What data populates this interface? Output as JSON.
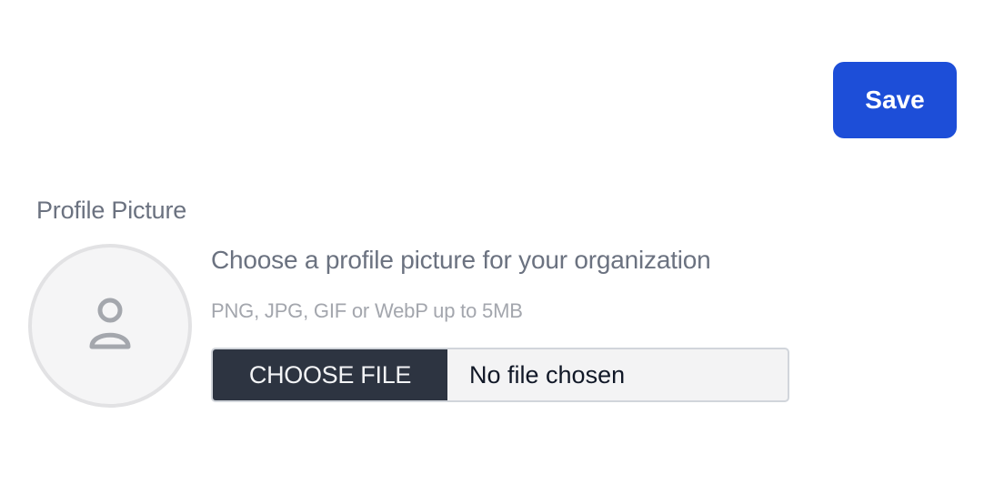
{
  "toolbar": {
    "save_label": "Save"
  },
  "profile_picture": {
    "label": "Profile Picture",
    "description": "Choose a profile picture for your organization",
    "hint": "PNG, JPG, GIF or WebP up to 5MB",
    "choose_file_label": "CHOOSE FILE",
    "file_status": "No file chosen",
    "avatar_icon": "user-icon"
  },
  "colors": {
    "primary": "#1d4ed8",
    "choose_button_bg": "#2d3441",
    "muted_text": "#6b7280"
  }
}
